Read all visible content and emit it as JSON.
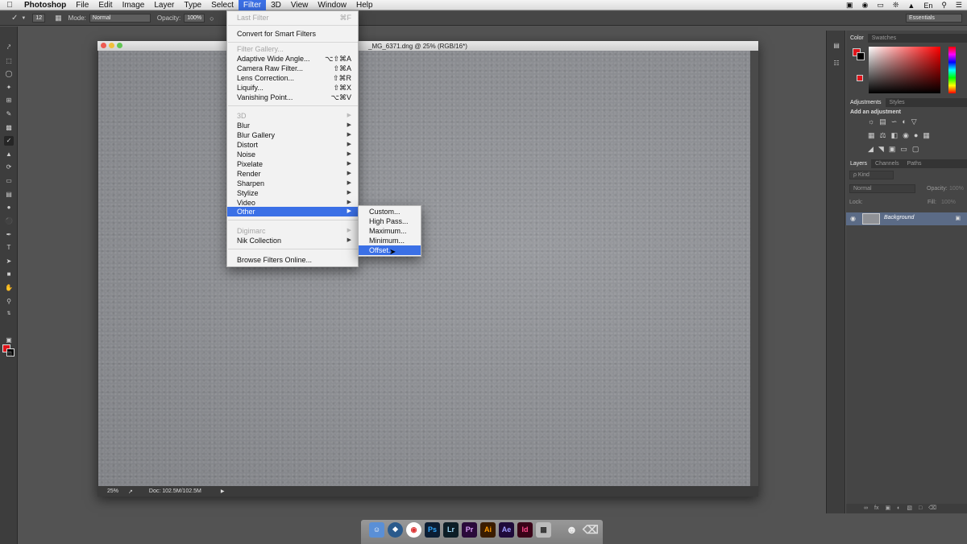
{
  "menubar": {
    "app_name": "Photoshop",
    "items": [
      "File",
      "Edit",
      "Image",
      "Layer",
      "Type",
      "Select",
      "Filter",
      "3D",
      "View",
      "Window",
      "Help"
    ],
    "active_item": "Filter",
    "language": "En"
  },
  "options_bar": {
    "brush_size": "12",
    "mode_label": "Mode:",
    "mode_value": "Normal",
    "opacity_label": "Opacity:",
    "opacity_value": "100%",
    "workspace": "Essentials"
  },
  "document": {
    "title": "_MG_6371.dng @ 25% (RGB/16*)",
    "zoom": "25%",
    "doc_size": "Doc: 102.5M/102.5M"
  },
  "filter_menu": {
    "last_filter": "Last Filter",
    "last_filter_shortcut": "⌘F",
    "smart_filters": "Convert for Smart Filters",
    "gallery": "Filter Gallery...",
    "adaptive": "Adaptive Wide Angle...",
    "adaptive_sc": "⌥⇧⌘A",
    "camera_raw": "Camera Raw Filter...",
    "camera_raw_sc": "⇧⌘A",
    "lens": "Lens Correction...",
    "lens_sc": "⇧⌘R",
    "liquify": "Liquify...",
    "liquify_sc": "⇧⌘X",
    "vanishing": "Vanishing Point...",
    "vanishing_sc": "⌥⌘V",
    "three_d": "3D",
    "blur": "Blur",
    "blur_gallery": "Blur Gallery",
    "distort": "Distort",
    "noise": "Noise",
    "pixelate": "Pixelate",
    "render": "Render",
    "sharpen": "Sharpen",
    "stylize": "Stylize",
    "video": "Video",
    "other": "Other",
    "digimarc": "Digimarc",
    "nik": "Nik Collection",
    "browse": "Browse Filters Online..."
  },
  "other_submenu": {
    "custom": "Custom...",
    "high_pass": "High Pass...",
    "maximum": "Maximum...",
    "minimum": "Minimum...",
    "offset": "Offset..."
  },
  "panels": {
    "color_tab": "Color",
    "swatches_tab": "Swatches",
    "adjustments_tab": "Adjustments",
    "styles_tab": "Styles",
    "add_adjustment": "Add an adjustment",
    "layers_tab": "Layers",
    "channels_tab": "Channels",
    "paths_tab": "Paths",
    "kind_filter": "ρ Kind",
    "blend_mode": "Normal",
    "opacity_label": "Opacity:",
    "opacity_value": "100%",
    "lock_label": "Lock:",
    "fill_label": "Fill:",
    "fill_value": "100%",
    "layer_name": "Background"
  },
  "colors": {
    "foreground": "#e0141a",
    "background": "#000000",
    "menu_highlight": "#3b70e6"
  },
  "dock": {
    "apps": [
      "Ps",
      "Lr",
      "Pr",
      "Ai",
      "Ae",
      "Id"
    ]
  }
}
